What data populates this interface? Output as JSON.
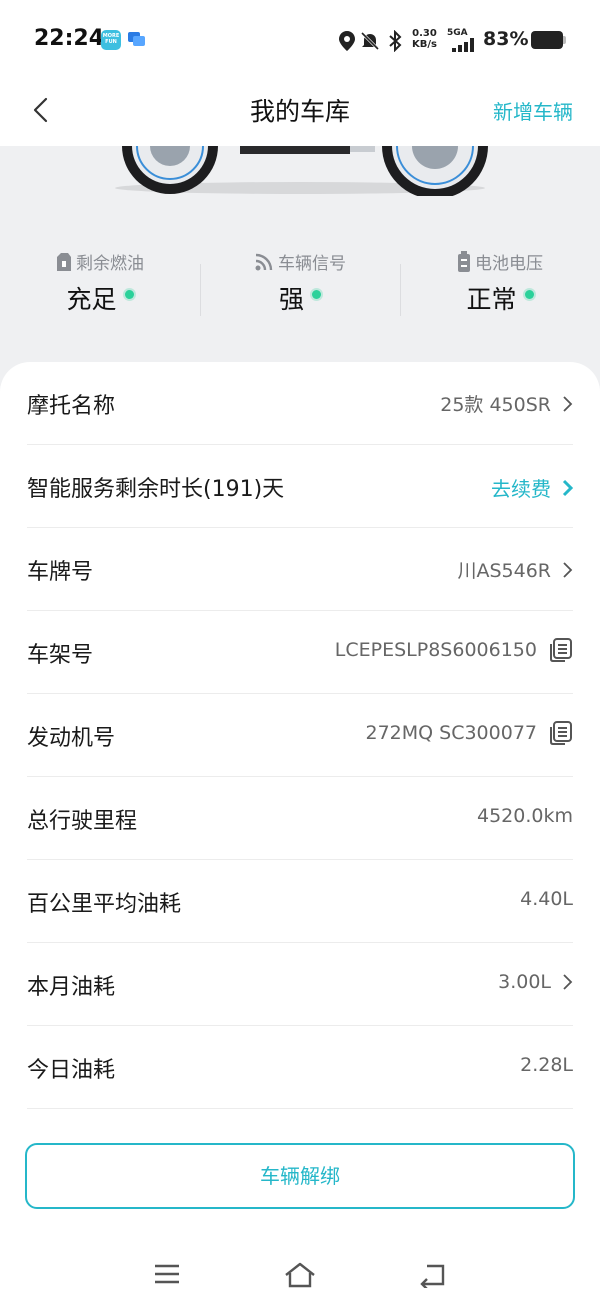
{
  "status_bar": {
    "time": "22:24",
    "app_icon_text": "MORE FUN",
    "net_speed_top": "0.30",
    "net_speed_bottom": "KB/s",
    "network": "5GA",
    "battery": "83%"
  },
  "header": {
    "title": "我的车库",
    "action": "新增车辆"
  },
  "stats": [
    {
      "label": "剩余燃油",
      "value": "充足",
      "icon": "fuel-icon",
      "status_color": "#2bd19a"
    },
    {
      "label": "车辆信号",
      "value": "强",
      "icon": "signal-icon",
      "status_color": "#2bd19a"
    },
    {
      "label": "电池电压",
      "value": "正常",
      "icon": "battery-icon",
      "status_color": "#2bd19a"
    }
  ],
  "details": [
    {
      "label": "摩托名称",
      "value": "25款 450SR",
      "chevron": true
    },
    {
      "label": "智能服务剩余时长(191)天",
      "value": "去续费",
      "chevron": true,
      "accent": true
    },
    {
      "label": "车牌号",
      "value": "川AS546R",
      "chevron": true
    },
    {
      "label": "车架号",
      "value": "LCEPESLP8S6006150",
      "copy": true
    },
    {
      "label": "发动机号",
      "value": "272MQ SC300077",
      "copy": true
    },
    {
      "label": "总行驶里程",
      "value": "4520.0km"
    },
    {
      "label": "百公里平均油耗",
      "value": "4.40L"
    },
    {
      "label": "本月油耗",
      "value": "3.00L",
      "chevron": true
    },
    {
      "label": "今日油耗",
      "value": "2.28L"
    }
  ],
  "unbind_button": "车辆解绑",
  "colors": {
    "accent": "#25b7c9",
    "status_ok": "#2bd19a"
  }
}
